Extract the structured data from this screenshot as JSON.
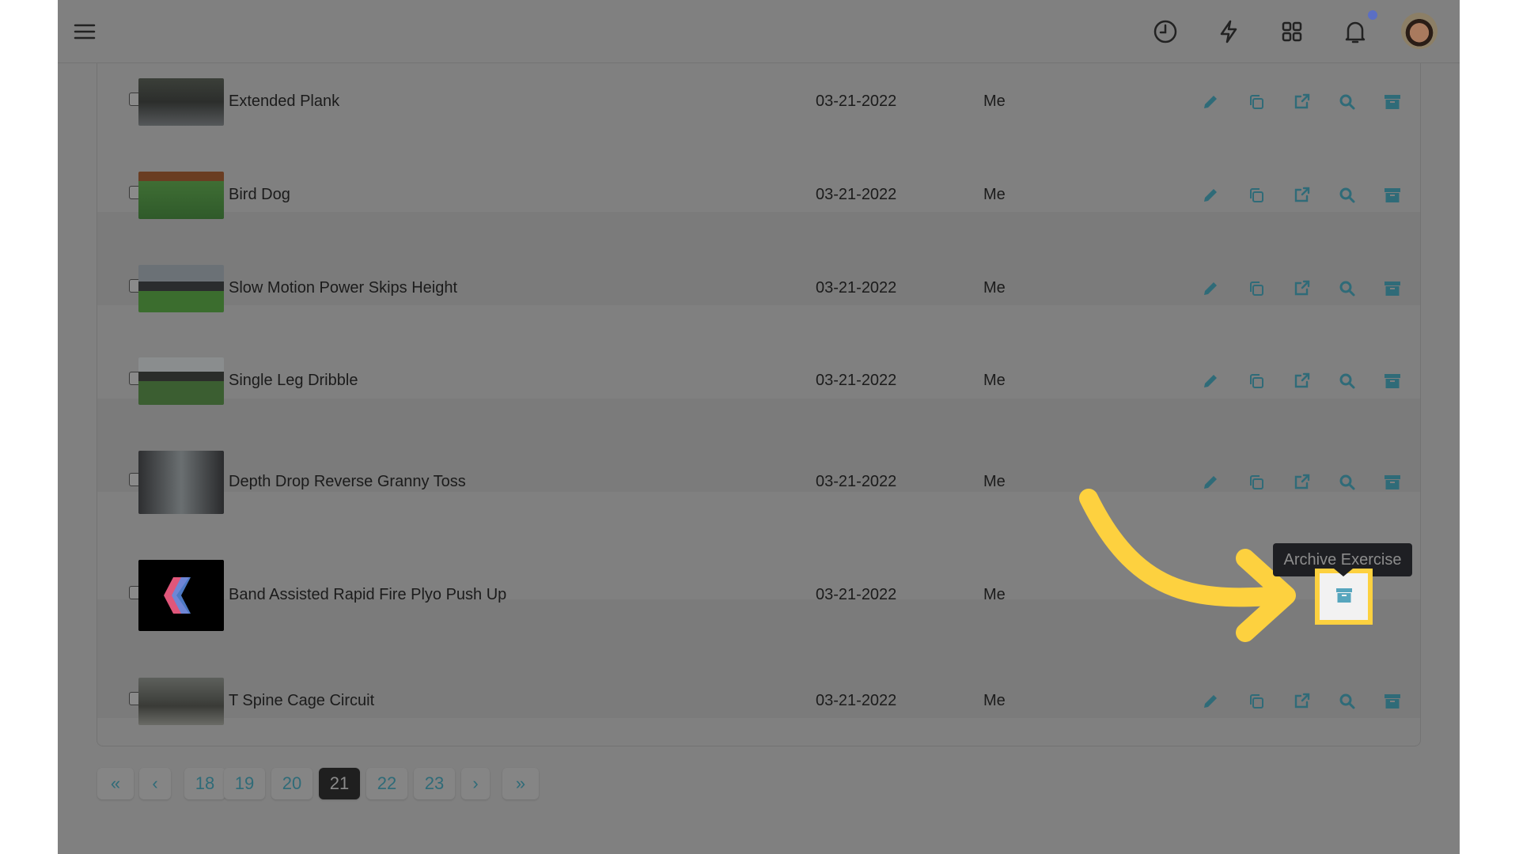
{
  "header": {
    "icons": [
      "menu-icon",
      "clock-icon",
      "lightning-icon",
      "apps-grid-icon",
      "bell-icon",
      "avatar"
    ],
    "notification_dot_color": "#5b6fc4"
  },
  "rows": [
    {
      "name": "Extended Plank",
      "date": "03-21-2022",
      "owner": "Me"
    },
    {
      "name": "Bird Dog",
      "date": "03-21-2022",
      "owner": "Me"
    },
    {
      "name": "Slow Motion Power Skips Height",
      "date": "03-21-2022",
      "owner": "Me"
    },
    {
      "name": "Single Leg Dribble",
      "date": "03-21-2022",
      "owner": "Me"
    },
    {
      "name": "Depth Drop Reverse Granny Toss",
      "date": "03-21-2022",
      "owner": "Me"
    },
    {
      "name": "Band Assisted Rapid Fire Plyo Push Up",
      "date": "03-21-2022",
      "owner": "Me"
    },
    {
      "name": "T Spine Cage Circuit",
      "date": "03-21-2022",
      "owner": "Me"
    }
  ],
  "row_actions": [
    "edit-icon",
    "duplicate-icon",
    "open-external-icon",
    "search-icon",
    "archive-icon"
  ],
  "tooltip": "Archive Exercise",
  "pagination": {
    "first": "«",
    "prev": "‹",
    "pages": [
      "18",
      "19",
      "20",
      "21",
      "22",
      "23"
    ],
    "current": "21",
    "next": "›",
    "last": "»"
  },
  "colors": {
    "accent": "#2f6b78",
    "highlight": "#fdd13f",
    "archive_icon": "#56a5bd"
  }
}
